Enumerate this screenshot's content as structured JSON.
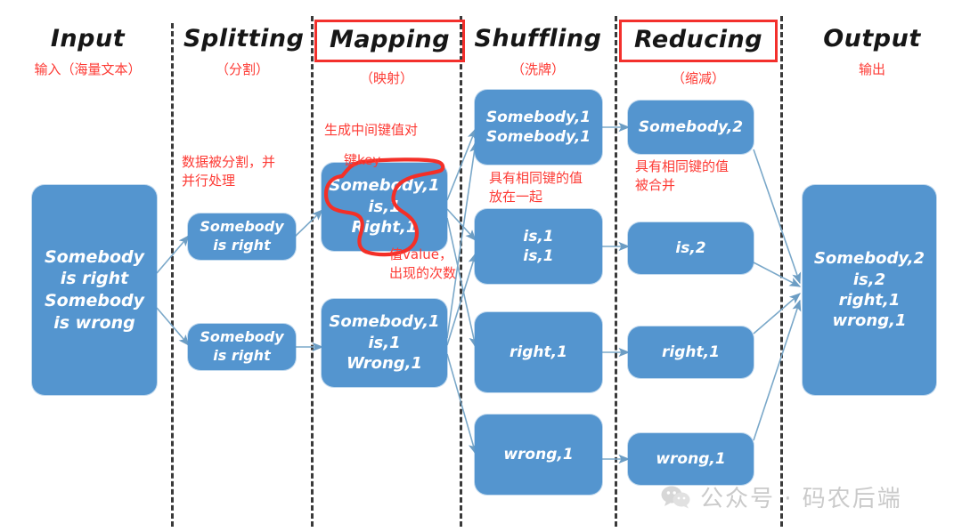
{
  "colors": {
    "node_fill": "#5495cf",
    "annotation_red": "#fd3a34",
    "header_box_red": "#f3302c",
    "arrow_blue": "#7aa8c9",
    "divider": "#3a3a3a",
    "text_white": "#ffffff",
    "title_black": "#161616"
  },
  "columns": [
    {
      "title": "Input",
      "subtitle": "输入（海量文本）",
      "boxed": false
    },
    {
      "title": "Splitting",
      "subtitle": "（分割）",
      "boxed": false
    },
    {
      "title": "Mapping",
      "subtitle": "（映射）",
      "boxed": true
    },
    {
      "title": "Shuffling",
      "subtitle": "（洗牌）",
      "boxed": false
    },
    {
      "title": "Reducing",
      "subtitle": "（缩减）",
      "boxed": true
    },
    {
      "title": "Output",
      "subtitle": "输出",
      "boxed": false
    }
  ],
  "nodes": {
    "input": {
      "lines": [
        "Somebody",
        "is right",
        "Somebody",
        "is wrong"
      ]
    },
    "splitting": [
      {
        "lines": [
          "Somebody",
          "is right"
        ]
      },
      {
        "lines": [
          "Somebody",
          "is right"
        ]
      }
    ],
    "mapping": [
      {
        "lines": [
          "Somebody,1",
          "is,1",
          "Right,1"
        ]
      },
      {
        "lines": [
          "Somebody,1",
          "is,1",
          "Wrong,1"
        ]
      }
    ],
    "shuffling": [
      {
        "lines": [
          "Somebody,1",
          "Somebody,1"
        ]
      },
      {
        "lines": [
          "is,1",
          "is,1"
        ]
      },
      {
        "lines": [
          "right,1"
        ]
      },
      {
        "lines": [
          "wrong,1"
        ]
      }
    ],
    "reducing": [
      {
        "lines": [
          "Somebody,2"
        ]
      },
      {
        "lines": [
          "is,2"
        ]
      },
      {
        "lines": [
          "right,1"
        ]
      },
      {
        "lines": [
          "wrong,1"
        ]
      }
    ],
    "output": {
      "lines": [
        "Somebody,2",
        "is,2",
        "right,1",
        "wrong,1"
      ]
    }
  },
  "annotations": {
    "splitting_note": "数据被分割，并\n并行处理",
    "mapping_note": "生成中间键值对",
    "key_label": "键key",
    "value_label": "值value，\n出现的次数",
    "shuffling_note": "具有相同键的值\n放在一起",
    "reducing_note": "具有相同键的值\n被合并"
  },
  "watermark": {
    "text": "公众号 · 码农后端",
    "icon": "wechat-icon"
  }
}
